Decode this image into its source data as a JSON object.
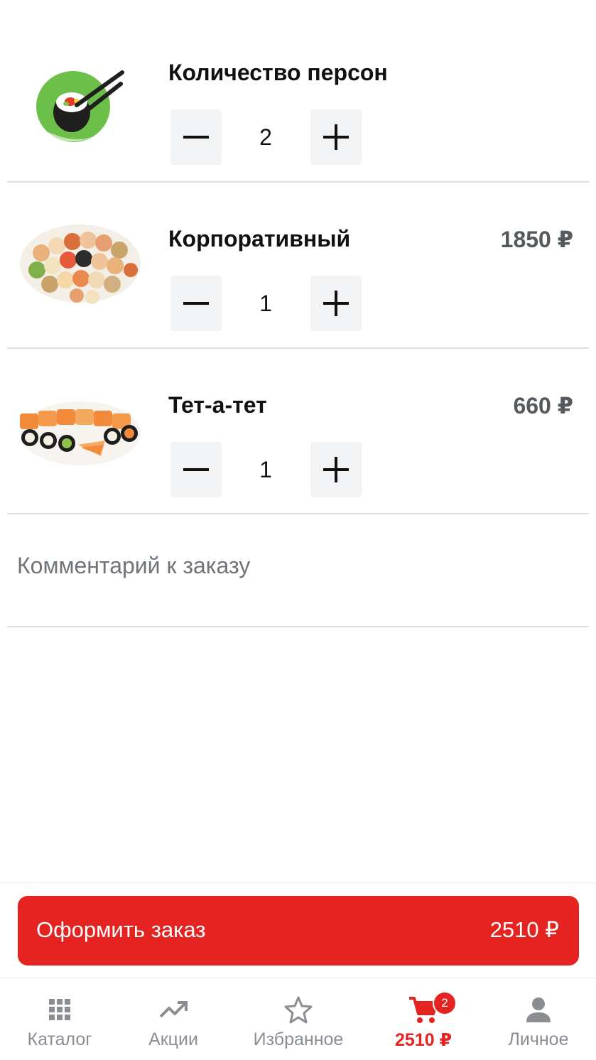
{
  "persons": {
    "title": "Количество персон",
    "quantity": "2"
  },
  "cart_items": [
    {
      "name": "Корпоративный",
      "price": "1850 ₽",
      "quantity": "1"
    },
    {
      "name": "Тет-а-тет",
      "price": "660 ₽",
      "quantity": "1"
    }
  ],
  "comment": {
    "placeholder": "Комментарий к заказу"
  },
  "checkout": {
    "label": "Оформить заказ",
    "total": "2510 ₽"
  },
  "tabbar": {
    "items": [
      {
        "label": "Каталог",
        "icon": "grid-icon"
      },
      {
        "label": "Акции",
        "icon": "trending-up-icon"
      },
      {
        "label": "Избранное",
        "icon": "star-icon"
      },
      {
        "label": "2510 ₽",
        "icon": "cart-icon",
        "badge": "2",
        "active": true
      },
      {
        "label": "Личное",
        "icon": "person-icon"
      }
    ]
  },
  "colors": {
    "accent": "#e52320",
    "muted": "#8a8e93",
    "stepper_bg": "#f2f3f5",
    "logo_green": "#6cc04a"
  }
}
